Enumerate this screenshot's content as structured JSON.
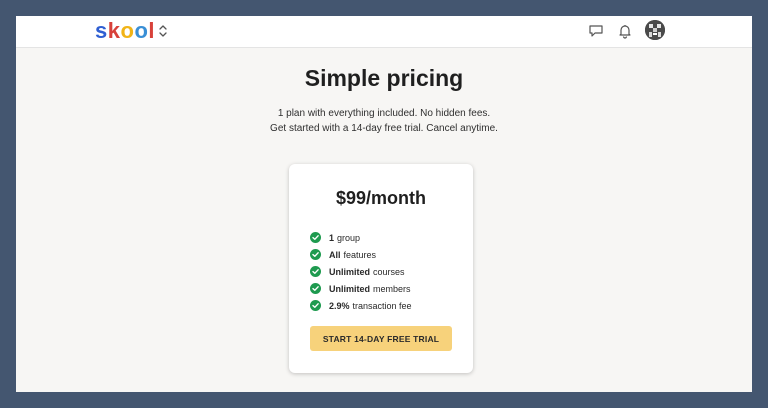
{
  "header": {
    "logo_letters": [
      {
        "char": "s",
        "color": "#2f5fd2"
      },
      {
        "char": "k",
        "color": "#d8413a"
      },
      {
        "char": "o",
        "color": "#f1b417"
      },
      {
        "char": "o",
        "color": "#3a8fd6"
      },
      {
        "char": "l",
        "color": "#d8413a"
      }
    ],
    "icons": [
      "group-switcher-icon",
      "chat-icon",
      "bell-icon",
      "user-avatar"
    ]
  },
  "main": {
    "title": "Simple pricing",
    "subtitle_line1": "1 plan with everything included. No hidden fees.",
    "subtitle_line2": "Get started with a 14-day free trial. Cancel anytime."
  },
  "plan": {
    "price": "$99/month",
    "features": [
      {
        "bold": "1",
        "rest": "group"
      },
      {
        "bold": "All",
        "rest": "features"
      },
      {
        "bold": "Unlimited",
        "rest": "courses"
      },
      {
        "bold": "Unlimited",
        "rest": "members"
      },
      {
        "bold": "2.9%",
        "rest": "transaction fee"
      }
    ],
    "cta_label": "START 14-DAY FREE TRIAL"
  },
  "colors": {
    "page_background": "#f7f6f4",
    "frame": "#445670",
    "check": "#1e9a4f",
    "cta": "#f7d27b"
  }
}
